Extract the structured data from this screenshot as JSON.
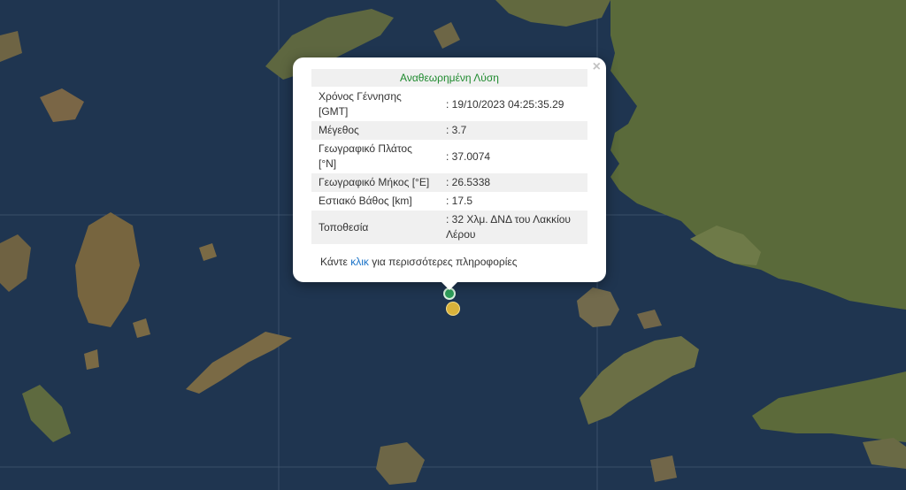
{
  "popup": {
    "title": "Αναθεωρημένη Λύση",
    "close_symbol": "×",
    "rows": [
      {
        "label": "Χρόνος Γέννησης [GMT]",
        "value": ": 19/10/2023 04:25:35.29"
      },
      {
        "label": "Μέγεθος",
        "value": ": 3.7"
      },
      {
        "label": "Γεωγραφικό Πλάτος [°N]",
        "value": ": 37.0074"
      },
      {
        "label": "Γεωγραφικό Μήκος [°E]",
        "value": ": 26.5338"
      },
      {
        "label": "Εστιακό Βάθος [km]",
        "value": ": 17.5"
      },
      {
        "label": "Τοποθεσία",
        "value": ": 32 Χλμ. ΔΝΔ του Λακκίου Λέρου"
      }
    ],
    "more_prefix": "Κάντε ",
    "more_link": "κλικ",
    "more_suffix": " για περισσότερες πληροφορίες"
  },
  "markers": [
    {
      "name": "earthquake-epicenter",
      "color": "#2e9e5a"
    },
    {
      "name": "earthquake-other",
      "color": "#d9b23a"
    }
  ]
}
